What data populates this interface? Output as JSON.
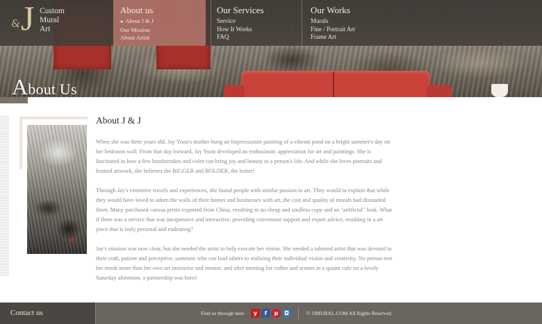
{
  "logo": {
    "ampersand": "&",
    "letter": "J",
    "lines": [
      "Custom",
      "Mural",
      "Art"
    ]
  },
  "nav": {
    "about": {
      "title": "About us",
      "items": [
        "About J & J",
        "Our Mission",
        "About Artist"
      ]
    },
    "services": {
      "title": "Our Services",
      "items": [
        "Service",
        "How It Works",
        "FAQ"
      ]
    },
    "works": {
      "title": "Our Works",
      "items": [
        "Murals",
        "Fine / Portrait Art",
        "Frame Art"
      ]
    }
  },
  "hero": {
    "heading_initial": "A",
    "heading_rest": "bout Us"
  },
  "article": {
    "title": "About J & J",
    "paragraphs": [
      "When she was three years old, Jay Yoon's mother hung an Impressionist painting of a vibrant pond on a bright summer's day on her bedroom wall. From that day forward, Jay Yoon developed an enthusiastic appreciation for art and paintings. She is fascinated in how a few brushstrokes and color can bring joy and beauty to a person's life. And while she loves portraits and framed artwork, she believes the BIGGER and BOLDER, the better!",
      "Through Jay's extensive travels and experiences, she found people with similar passion to art. They would to explain that while they would have loved to adorn the walls of their homes and businesses with art, the cost and quality of murals had dissuaded them. Many purchased canvas prints exported from China, resulting in an cheap and soulless copy and an \"artificial\" look. What if there was a service that was inexpensive and interactive, providing convenient support and expert advice, resulting in a art piece that is truly personal and endearing?",
      "Jay's mission was now clear, but she needed the artist to help execute her vision. She needed a talented artist that was devoted to their craft, patient and perceptive, someone who can lead others to realizing their individual vision and creativity. No person met her needs more than her own art instructor and mentor, and after meeting for coffee and scones in a quaint cafe on a lovely Saturday afternoon, a partnership was born!"
    ]
  },
  "footer": {
    "contact": "Contact us",
    "find_us": "Find us through here",
    "social": [
      {
        "icon": "yelp-icon",
        "glyph": "y"
      },
      {
        "icon": "facebook-icon",
        "glyph": "f"
      },
      {
        "icon": "pinterest-icon",
        "glyph": "p"
      },
      {
        "icon": "instagram-icon",
        "glyph": "◘"
      }
    ],
    "copyright": "© JJMURAL.COM All Rights Reserved."
  },
  "colors": {
    "accent_red": "#c9433a",
    "nav_highlight": "#ba766c",
    "footer_dark": "#4a4641",
    "footer": "#6a655f",
    "body_text": "#8a8580"
  }
}
